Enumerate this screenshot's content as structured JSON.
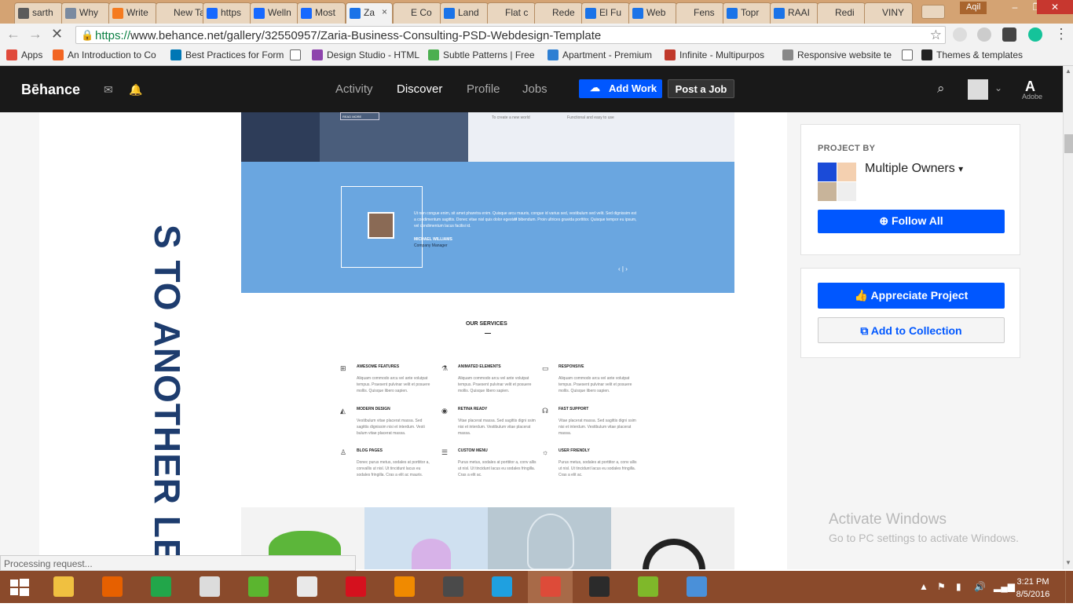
{
  "colors": {
    "behance_blue": "#0057ff",
    "testimonial_bg": "#6aa6e0",
    "tab_strip": "#d4a373",
    "taskbar": "#8a4a2b"
  },
  "tabs": [
    {
      "label": "sarth",
      "icon": "hash-icon",
      "color": "#5b5b5b"
    },
    {
      "label": "Why",
      "icon": "database-icon",
      "color": "#7a8aa0"
    },
    {
      "label": "Write",
      "icon": "xampp-icon",
      "color": "#f57b20"
    },
    {
      "label": "New Tab",
      "icon": "",
      "color": "transparent"
    },
    {
      "label": "https",
      "icon": "behance-icon",
      "color": "#1769ff"
    },
    {
      "label": "Welln",
      "icon": "behance-icon",
      "color": "#1769ff"
    },
    {
      "label": "Most",
      "icon": "behance-icon",
      "color": "#1769ff"
    },
    {
      "label": "Za",
      "icon": "loading-spinner-icon",
      "color": "#1a73e8",
      "active": true,
      "close": "×"
    },
    {
      "label": "E Co",
      "icon": "",
      "color": "transparent"
    },
    {
      "label": "Land",
      "icon": "loading-spinner-icon",
      "color": "#1a73e8"
    },
    {
      "label": "Flat c",
      "icon": "",
      "color": "transparent"
    },
    {
      "label": "Rede",
      "icon": "",
      "color": "transparent"
    },
    {
      "label": "El Fu",
      "icon": "loading-spinner-icon",
      "color": "#1a73e8"
    },
    {
      "label": "Web",
      "icon": "loading-spinner-icon",
      "color": "#1a73e8"
    },
    {
      "label": "Fens",
      "icon": "",
      "color": "transparent"
    },
    {
      "label": "Topr",
      "icon": "loading-spinner-icon",
      "color": "#1a73e8"
    },
    {
      "label": "RAAI",
      "icon": "loading-spinner-icon",
      "color": "#1a73e8"
    },
    {
      "label": "Redi",
      "icon": "",
      "color": "transparent"
    },
    {
      "label": "VINY",
      "icon": "",
      "color": "transparent"
    }
  ],
  "window": {
    "user": "Aqil",
    "minimize": "–",
    "maximize": "❐",
    "close": "✕"
  },
  "toolbar": {
    "back": "←",
    "forward": "→",
    "reload": "✕",
    "url_scheme": "https://",
    "url_rest": "www.behance.net/gallery/32550957/Zaria-Business-Consulting-PSD-Webdesign-Template",
    "star": "☆"
  },
  "bookmarks": [
    {
      "label": "Apps",
      "icon": "apps-grid-icon",
      "color": "#e04a3b"
    },
    {
      "label": "An Introduction to Co",
      "icon": "plus-square-icon",
      "color": "#f26522"
    },
    {
      "label": "Best Practices for Form",
      "icon": "linkedin-icon",
      "color": "#0077b5"
    },
    {
      "label": "",
      "icon": "page-icon",
      "color": "#ffffff"
    },
    {
      "label": "Design Studio - HTML",
      "icon": "d-logo-icon",
      "color": "#8e44ad"
    },
    {
      "label": "Subtle Patterns | Free",
      "icon": "patterns-icon",
      "color": "#4caf50"
    },
    {
      "label": "Apartment - Premium",
      "icon": "home-icon",
      "color": "#2d7fd3"
    },
    {
      "label": "Infinite - Multipurpos",
      "icon": "wp-icon",
      "color": "#c0392b"
    },
    {
      "label": "Responsive website te",
      "icon": "diamond-icon",
      "color": "#888888"
    },
    {
      "label": "",
      "icon": "page-icon",
      "color": "#ffffff"
    },
    {
      "label": "Themes & templates",
      "icon": "w-logo-icon",
      "color": "#222222"
    }
  ],
  "behance": {
    "logo": "Bēhance",
    "nav": [
      "Activity",
      "Discover",
      "Profile",
      "Jobs"
    ],
    "active_nav": "Discover",
    "add_work": "Add Work",
    "post_job": "Post a Job",
    "adobe": "Adobe"
  },
  "project": {
    "vertical_text": "S TO ANOTHER LEVEL",
    "read_more": "READ MORE",
    "hero_caption_1": "To create a new world",
    "hero_caption_2": "Functional and easy to use",
    "testimonial": {
      "quote_mark": "“",
      "text": "Ut non congue enim, sit amet pharetra enim. Quisque arcu mauris, congue id varius sed, vestibulum sed velit. Sed dignissim est a condimentum sagittis. Donec vitae nisl quis dolor egestas bibendum. Proin ultrices gravida porttitor. Quisque tempor eu ipsum, vel condimentum lacus facilisi id.",
      "name": "MICHAEL WILLIAMS",
      "role": "Company Manager",
      "nav": "‹ | ›"
    },
    "services_title": "OUR SERVICES",
    "services": [
      {
        "title": "AWESOME FEATURES",
        "icon": "grid-icon",
        "glyph": "⊞",
        "desc": "Aliquam commodo arcu vel ante volutpat tempus. Praesent pulvinar velit et posuere mollis. Quisque libero sapien."
      },
      {
        "title": "ANIMATED ELEMENTS",
        "icon": "flask-icon",
        "glyph": "⚗",
        "desc": "Aliquam commodo arcu vel ante volutpat tempus. Praesent pulvinar velit et posuere mollis. Quisque libero sapien."
      },
      {
        "title": "RESPONSIVE",
        "icon": "monitor-icon",
        "glyph": "▭",
        "desc": "Aliquam commodo arcu vel ante volutpat tempus. Praesent pulvinar velit et posuere mollis. Quisque libero sapien."
      },
      {
        "title": "MODERN DESIGN",
        "icon": "ruler-icon",
        "glyph": "◭",
        "desc": "Vestibulum vitae placerat massa. Sed sagittis dignissim nisi et interdum. Vesti bulum vitae placerat massa."
      },
      {
        "title": "RETINA READY",
        "icon": "eye-icon",
        "glyph": "◉",
        "desc": "Vitae placerat massa. Sed sagittis digni ssim nisi et interdum. Vestibulum vitae placerat massa."
      },
      {
        "title": "FAST SUPPORT",
        "icon": "headset-icon",
        "glyph": "☊",
        "desc": "Vitae placerat massa. Sed sagittis digni ssim nisi et interdum. Vestibulum vitae placerat massa."
      },
      {
        "title": "BLOG PAGES",
        "icon": "user-icon",
        "glyph": "♙",
        "desc": "Donec purus metus, sodales at porttitor a, convallis ut nisl. Ut tincidunt lacus eu sodales fringilla. Cras a elit ac mauris."
      },
      {
        "title": "CUSTOM MENU",
        "icon": "menu-icon",
        "glyph": "☰",
        "desc": "Purus metus, sodales at porttitor a, conv allis ut nisl. Ut tincidunt lacus eu sodales fringilla. Cras a elit ac."
      },
      {
        "title": "USER FRIENDLY",
        "icon": "sun-icon",
        "glyph": "☼",
        "desc": "Purus metus, sodales at porttitor a, conv allis ut nisl. Ut tincidunt lacus eu sodales fringilla. Cras a elit ac."
      }
    ]
  },
  "sidebar": {
    "project_by": "PROJECT BY",
    "owners": "Multiple Owners",
    "owners_caret": "▾",
    "follow_all": "Follow All",
    "appreciate": "Appreciate Project",
    "add_collection": "Add to Collection"
  },
  "watermark": {
    "line1": "Activate Windows",
    "line2": "Go to PC settings to activate Windows."
  },
  "status": "Processing request...",
  "taskbar": {
    "apps": [
      {
        "name": "file-explorer-icon",
        "color": "#f0c040"
      },
      {
        "name": "firefox-icon",
        "color": "#e66000"
      },
      {
        "name": "store-icon",
        "color": "#22a64a"
      },
      {
        "name": "mail-icon",
        "color": "#dcdcdc"
      },
      {
        "name": "frog-app-icon",
        "color": "#5bb52f"
      },
      {
        "name": "snipping-tool-icon",
        "color": "#e9e9e9"
      },
      {
        "name": "opera-icon",
        "color": "#d5111e"
      },
      {
        "name": "vlc-icon",
        "color": "#f08a00"
      },
      {
        "name": "sublime-text-icon",
        "color": "#4a4a4a"
      },
      {
        "name": "internet-explorer-icon",
        "color": "#1fa0e0"
      },
      {
        "name": "chrome-icon",
        "color": "#dd4b39",
        "active": true
      },
      {
        "name": "e-app-icon",
        "color": "#2b2b2b"
      },
      {
        "name": "bluestacks-icon",
        "color": "#7fb82a"
      },
      {
        "name": "photos-icon",
        "color": "#4a90d9"
      }
    ],
    "time": "3:21 PM",
    "date": "8/5/2016"
  }
}
